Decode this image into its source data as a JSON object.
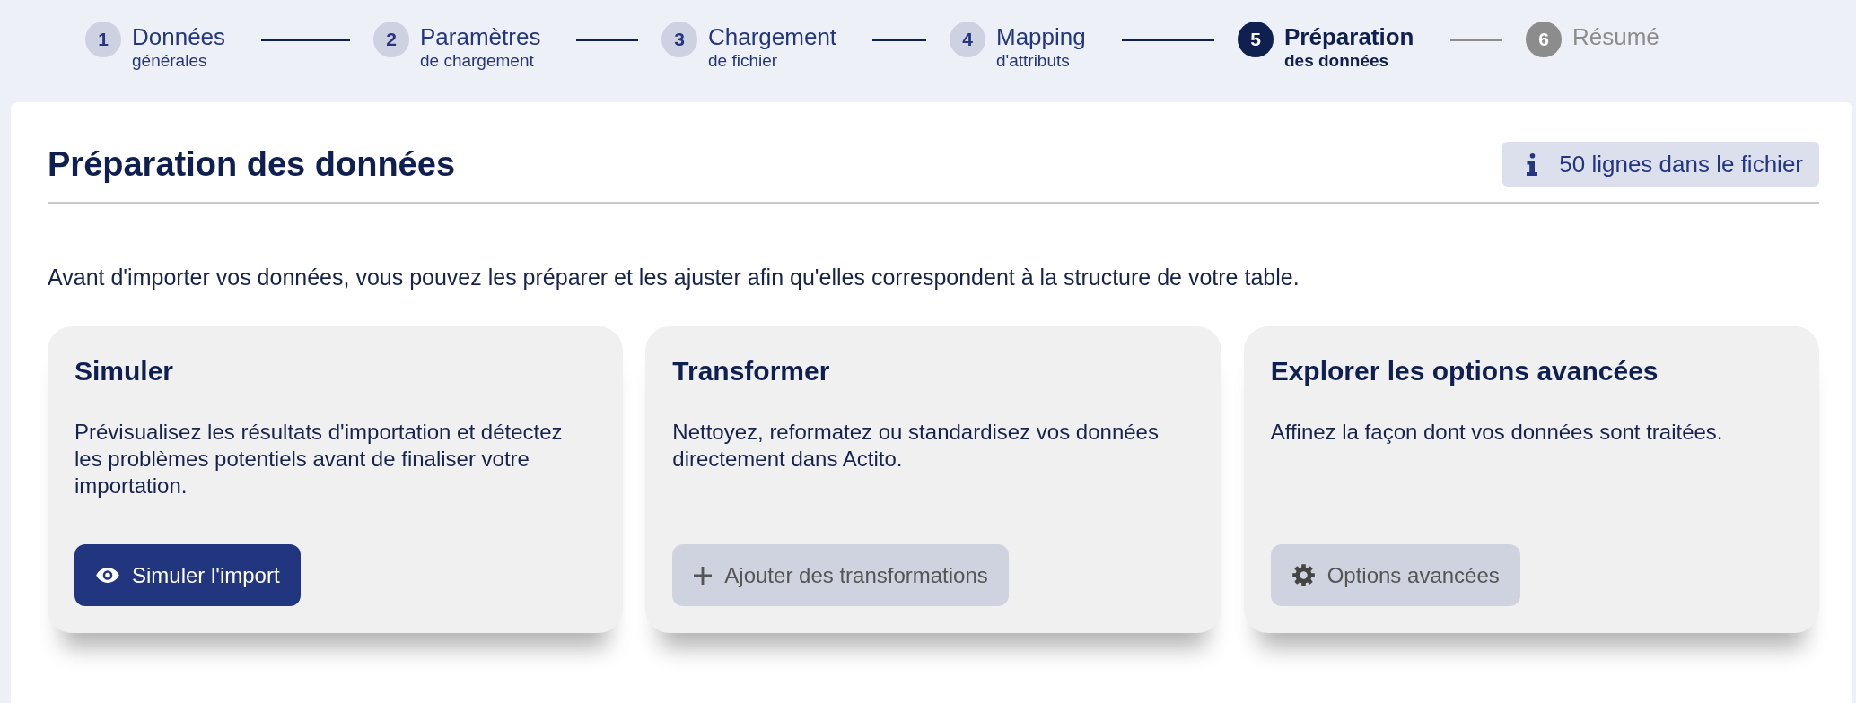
{
  "stepper": {
    "steps": [
      {
        "number": "1",
        "label": "Données",
        "sublabel": "générales",
        "completed": true,
        "selected": false
      },
      {
        "number": "2",
        "label": "Paramètres",
        "sublabel": "de chargement",
        "completed": true,
        "selected": false
      },
      {
        "number": "3",
        "label": "Chargement",
        "sublabel": "de fichier",
        "completed": true,
        "selected": false
      },
      {
        "number": "4",
        "label": "Mapping",
        "sublabel": "d'attributs",
        "completed": true,
        "selected": false
      },
      {
        "number": "5",
        "label": "Préparation",
        "sublabel": "des données",
        "completed": false,
        "selected": true
      },
      {
        "number": "6",
        "label": "Résumé",
        "completed": false,
        "selected": false
      }
    ]
  },
  "header": {
    "title": "Préparation des données",
    "info_badge": "50 lignes dans le fichier"
  },
  "description": "Avant d'importer vos données, vous pouvez les préparer et les ajuster afin qu'elles correspondent à la structure de votre table.",
  "cards": [
    {
      "title": "Simuler",
      "text": "Prévisualisez les résultats d'importation et détectez les problèmes potentiels avant de finaliser votre importation.",
      "button": {
        "label": "Simuler l'import",
        "disabled": false
      }
    },
    {
      "title": "Transformer",
      "text": "Nettoyez, reformatez ou standardisez vos données directement dans Actito.",
      "button": {
        "label": "Ajouter des transformations",
        "disabled": true
      }
    },
    {
      "title": "Explorer les options avancées",
      "text": "Affinez la façon dont vos données sont traitées.",
      "button": {
        "label": "Options avancées",
        "disabled": true
      }
    }
  ]
}
